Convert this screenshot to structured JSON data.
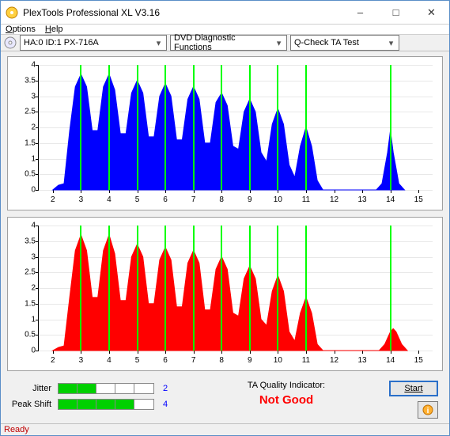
{
  "window": {
    "title": "PlexTools Professional XL V3.16"
  },
  "menu": {
    "options": "Options",
    "options_u": "O",
    "help": "Help",
    "help_u": "H"
  },
  "toolbar": {
    "device": "HA:0 ID:1  PX-716A",
    "mode": "DVD Diagnostic Functions",
    "test": "Q-Check TA Test"
  },
  "metrics": {
    "jitter_label": "Jitter",
    "jitter_value": "2",
    "jitter_bars": 2,
    "peak_label": "Peak Shift",
    "peak_value": "4",
    "peak_bars": 4
  },
  "quality": {
    "label": "TA Quality Indicator:",
    "value": "Not Good"
  },
  "buttons": {
    "start": "Start"
  },
  "status": "Ready",
  "chart_data": [
    {
      "type": "area",
      "color": "#0000ff",
      "ylim": [
        0,
        4
      ],
      "yticks": [
        0,
        0.5,
        1,
        1.5,
        2,
        2.5,
        3,
        3.5,
        4
      ],
      "xlim": [
        1.5,
        15.5
      ],
      "xticks": [
        2,
        3,
        4,
        5,
        6,
        7,
        8,
        9,
        10,
        11,
        12,
        13,
        14,
        15
      ],
      "vlines": [
        3,
        4,
        5,
        6,
        7,
        8,
        9,
        10,
        11,
        14
      ],
      "x": [
        2.0,
        2.2,
        2.4,
        2.6,
        2.8,
        3.0,
        3.2,
        3.4,
        3.6,
        3.8,
        4.0,
        4.2,
        4.4,
        4.6,
        4.8,
        5.0,
        5.2,
        5.4,
        5.6,
        5.8,
        6.0,
        6.2,
        6.4,
        6.6,
        6.8,
        7.0,
        7.2,
        7.4,
        7.6,
        7.8,
        8.0,
        8.2,
        8.4,
        8.6,
        8.8,
        9.0,
        9.2,
        9.4,
        9.6,
        9.8,
        10.0,
        10.2,
        10.4,
        10.6,
        10.8,
        11.0,
        11.2,
        11.4,
        11.6,
        11.8,
        12.0,
        13.5,
        13.7,
        13.9,
        14.0,
        14.1,
        14.3,
        14.5
      ],
      "y": [
        0,
        0.15,
        0.2,
        1.9,
        3.3,
        3.7,
        3.3,
        1.9,
        1.9,
        3.3,
        3.7,
        3.2,
        1.8,
        1.8,
        3.1,
        3.5,
        3.1,
        1.7,
        1.7,
        3.0,
        3.4,
        3.0,
        1.6,
        1.6,
        2.9,
        3.3,
        2.9,
        1.5,
        1.5,
        2.8,
        3.1,
        2.7,
        1.4,
        1.3,
        2.5,
        2.9,
        2.5,
        1.2,
        0.9,
        2.1,
        2.6,
        2.1,
        0.8,
        0.4,
        1.4,
        2.0,
        1.4,
        0.3,
        0,
        0,
        0,
        0,
        0.2,
        1.2,
        1.9,
        1.2,
        0.2,
        0
      ]
    },
    {
      "type": "area",
      "color": "#ff0000",
      "ylim": [
        0,
        4
      ],
      "yticks": [
        0,
        0.5,
        1,
        1.5,
        2,
        2.5,
        3,
        3.5,
        4
      ],
      "xlim": [
        1.5,
        15.5
      ],
      "xticks": [
        2,
        3,
        4,
        5,
        6,
        7,
        8,
        9,
        10,
        11,
        12,
        13,
        14,
        15
      ],
      "vlines": [
        3,
        4,
        5,
        6,
        7,
        8,
        9,
        10,
        11,
        14
      ],
      "x": [
        2.0,
        2.2,
        2.4,
        2.6,
        2.8,
        3.0,
        3.2,
        3.4,
        3.6,
        3.8,
        4.0,
        4.2,
        4.4,
        4.6,
        4.8,
        5.0,
        5.2,
        5.4,
        5.6,
        5.8,
        6.0,
        6.2,
        6.4,
        6.6,
        6.8,
        7.0,
        7.2,
        7.4,
        7.6,
        7.8,
        8.0,
        8.2,
        8.4,
        8.6,
        8.8,
        9.0,
        9.2,
        9.4,
        9.6,
        9.8,
        10.0,
        10.2,
        10.4,
        10.6,
        10.8,
        11.0,
        11.2,
        11.4,
        11.6,
        11.8,
        12.0,
        13.6,
        13.8,
        14.0,
        14.1,
        14.2,
        14.4,
        14.6
      ],
      "y": [
        0,
        0.1,
        0.15,
        1.7,
        3.2,
        3.7,
        3.2,
        1.7,
        1.7,
        3.2,
        3.7,
        3.1,
        1.6,
        1.6,
        3.0,
        3.4,
        3.0,
        1.5,
        1.5,
        2.9,
        3.3,
        2.9,
        1.4,
        1.4,
        2.8,
        3.2,
        2.8,
        1.3,
        1.3,
        2.6,
        3.0,
        2.6,
        1.2,
        1.1,
        2.3,
        2.7,
        2.3,
        1.0,
        0.8,
        1.9,
        2.4,
        1.9,
        0.6,
        0.3,
        1.2,
        1.7,
        1.2,
        0.2,
        0,
        0,
        0,
        0,
        0.2,
        0.6,
        0.7,
        0.6,
        0.2,
        0
      ]
    }
  ]
}
